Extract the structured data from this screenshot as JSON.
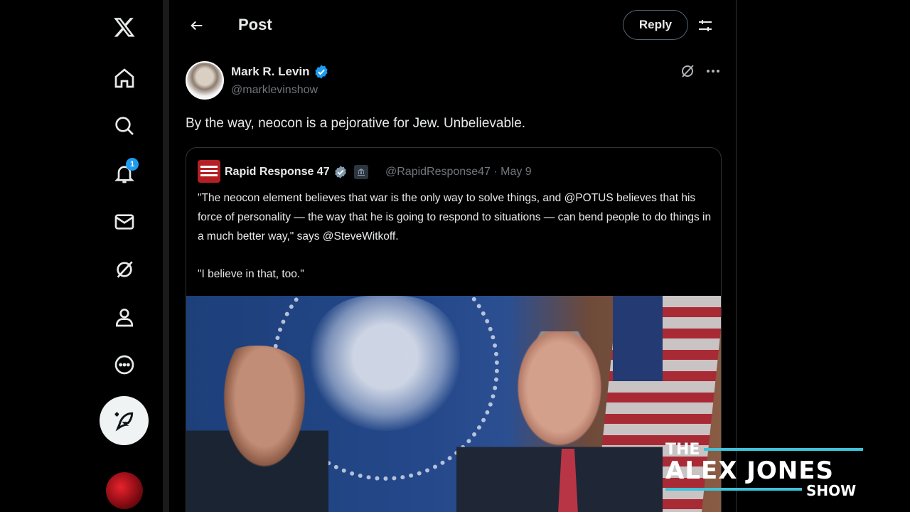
{
  "header": {
    "title": "Post",
    "reply_label": "Reply"
  },
  "nav": {
    "notifications_badge": "1"
  },
  "post": {
    "author_name": "Mark R. Levin",
    "author_handle": "@marklevinshow",
    "text": "By the way, neocon is a pejorative for Jew. Unbelievable."
  },
  "quote": {
    "author_name": "Rapid Response 47",
    "author_handle": "@RapidResponse47",
    "date": "May 9",
    "paragraph1": "\"The neocon element believes that war is the only way to solve things, and @POTUS believes that his force of personality — the way that he is going to respond to situations — can bend people to do things in a much better way,\" says @SteveWitkoff.",
    "paragraph2": "\"I believe in that, too.\""
  },
  "watermark": {
    "line1": "THE",
    "line2": "ALEX JONES",
    "line3": "SHOW"
  },
  "colors": {
    "accent": "#1d9bf0",
    "background": "#000000",
    "logo_bar": "#3fc3d9"
  }
}
